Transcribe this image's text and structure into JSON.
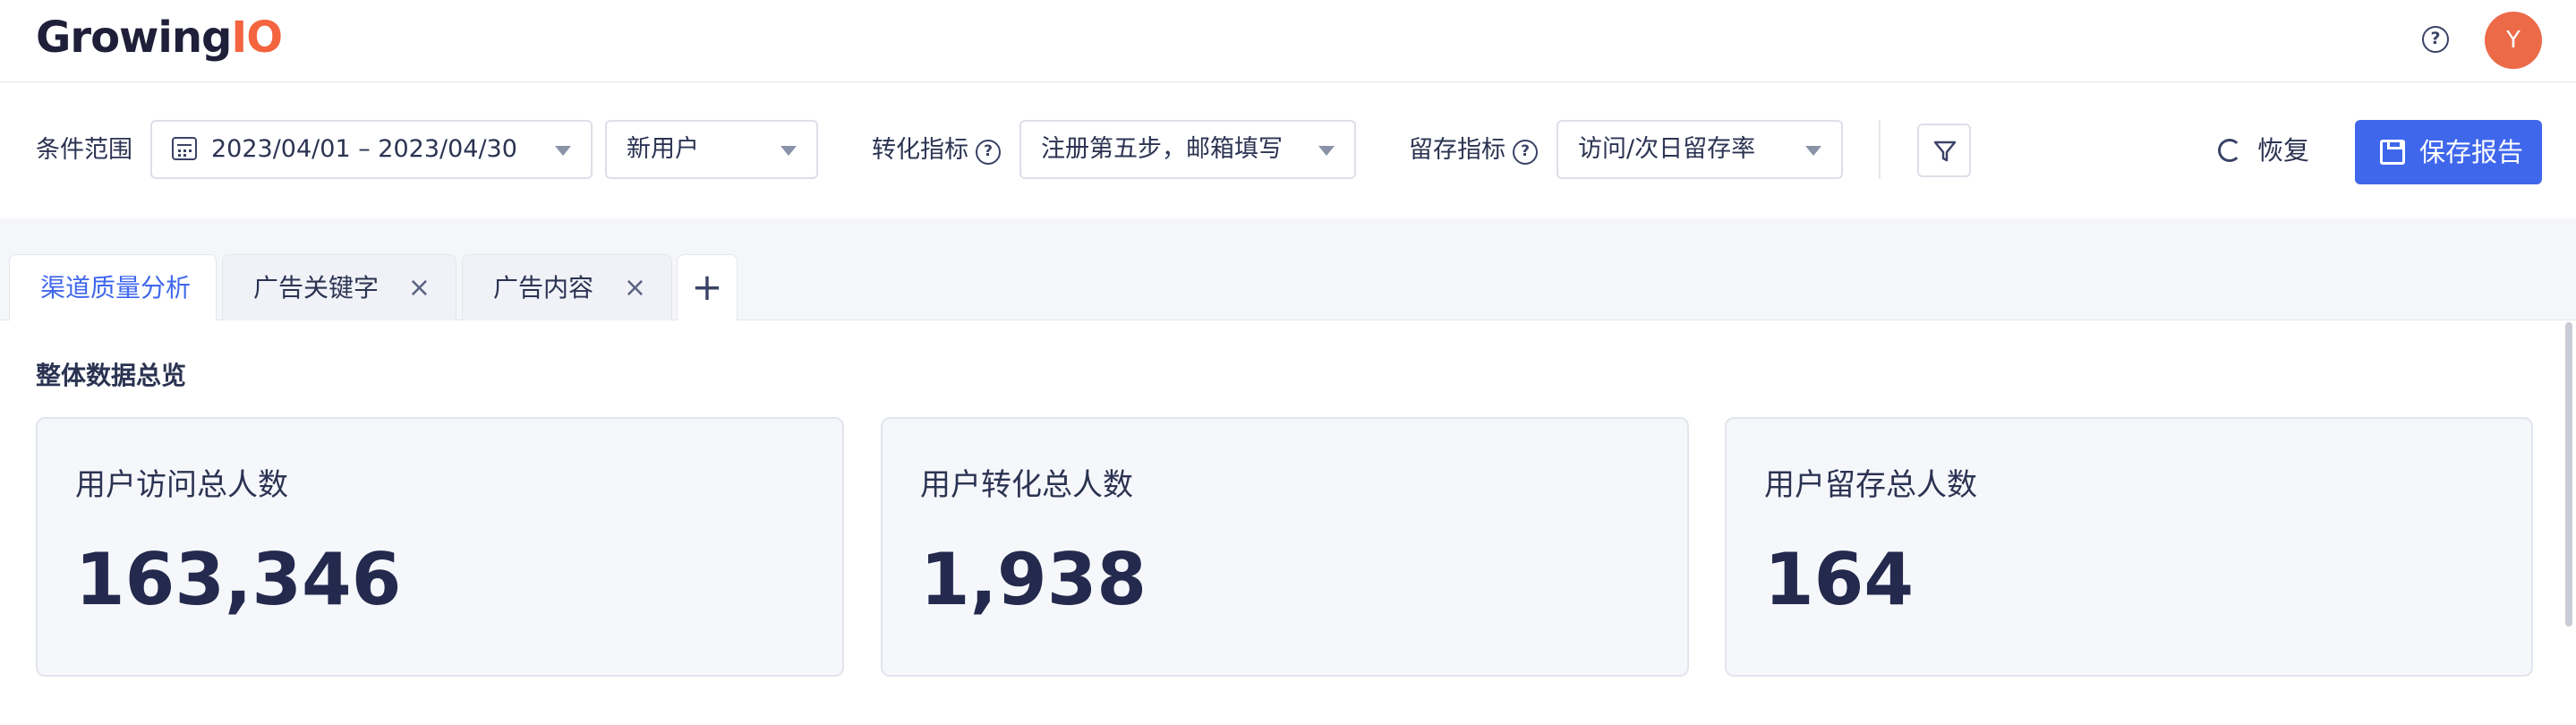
{
  "header": {
    "logo_main": "Growing",
    "logo_accent": "IO",
    "help_symbol": "?",
    "avatar_initial": "Y"
  },
  "filters": {
    "range_label": "条件范围",
    "date_range": "2023/04/01 – 2023/04/30",
    "user_type": "新用户",
    "conversion_label": "转化指标",
    "conversion_value": "注册第五步，邮箱填写",
    "retention_label": "留存指标",
    "retention_value": "访问/次日留存率",
    "restore_label": "恢复",
    "save_label": "保存报告"
  },
  "tabs": [
    {
      "label": "渠道质量分析",
      "active": true
    },
    {
      "label": "广告关键字",
      "active": false
    },
    {
      "label": "广告内容",
      "active": false
    }
  ],
  "tab_close_symbol": "×",
  "tab_add_symbol": "+",
  "overview": {
    "title": "整体数据总览",
    "cards": [
      {
        "title": "用户访问总人数",
        "value": "163,346"
      },
      {
        "title": "用户转化总人数",
        "value": "1,938"
      },
      {
        "title": "用户留存总人数",
        "value": "164"
      }
    ]
  },
  "colors": {
    "primary": "#3f67ec",
    "brand_accent": "#f3643f",
    "avatar": "#ec6a48",
    "text": "#2b3352"
  },
  "icons": [
    "help-icon",
    "calendar-icon",
    "chevron-down-icon",
    "filter-icon",
    "refresh-icon",
    "save-icon",
    "close-icon",
    "plus-icon"
  ]
}
